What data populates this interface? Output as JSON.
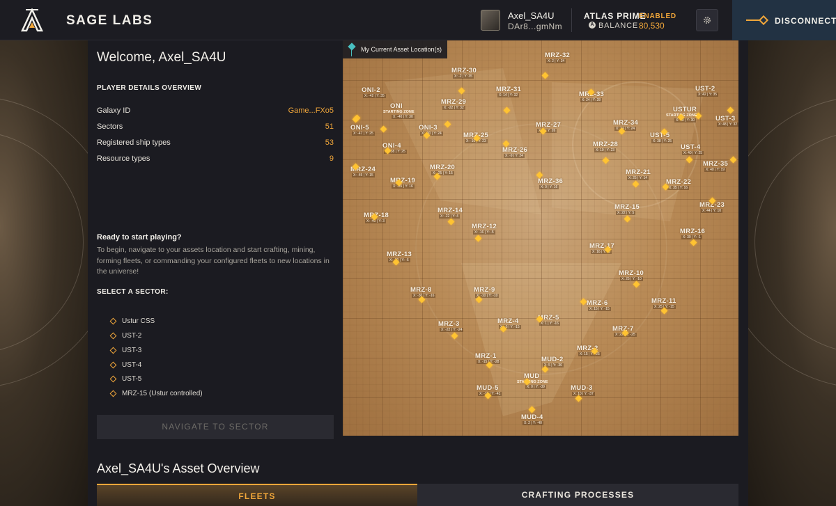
{
  "header": {
    "brand": "SAGE LABS",
    "user_name": "Axel_SA4U",
    "user_wallet": "DAr8...gmNm",
    "atlas_label": "ATLAS PRIME",
    "atlas_status": "ENABLED",
    "balance_label": "BALANCE",
    "balance_value": "80,530",
    "disconnect_label": "DISCONNECT",
    "accent_color": "#f0a63a"
  },
  "welcome": {
    "title": "Welcome, Axel_SA4U"
  },
  "player_details": {
    "heading": "PLAYER DETAILS OVERVIEW",
    "rows": [
      {
        "label": "Galaxy ID",
        "value": "Game...FXo5"
      },
      {
        "label": "Sectors",
        "value": "51"
      },
      {
        "label": "Registered ship types",
        "value": "53"
      },
      {
        "label": "Resource types",
        "value": "9"
      }
    ]
  },
  "ready": {
    "title": "Ready to start playing?",
    "text": "To begin, navigate to your assets location and start crafting, mining, forming fleets, or commanding your configured fleets to new locations in the universe!"
  },
  "select_sector": {
    "heading": "SELECT A SECTOR:",
    "items": [
      "Ustur CSS",
      "UST-2",
      "UST-3",
      "UST-4",
      "UST-5",
      "MRZ-15 (Ustur controlled)"
    ],
    "button": "NAVIGATE TO SECTOR"
  },
  "map": {
    "legend": "My Current Asset Location(s)",
    "sectors": [
      {
        "name": "MRZ-32",
        "coord": "X: 2 | Y: 34",
        "sub": ""
      },
      {
        "name": "MRZ-30",
        "coord": "X: -2 | Y: 35",
        "sub": ""
      },
      {
        "name": "MRZ-31",
        "coord": "X: 14 | Y: 32",
        "sub": ""
      },
      {
        "name": "MRZ-33",
        "coord": "X: 24 | Y: 28",
        "sub": ""
      },
      {
        "name": "ONI-2",
        "coord": "X: -42 | Y: 35",
        "sub": ""
      },
      {
        "name": "ONI",
        "coord": "X: -40 | Y: 30",
        "sub": "STARTING ZONE"
      },
      {
        "name": "MRZ-29",
        "coord": "X: -22 | Y: 32",
        "sub": ""
      },
      {
        "name": "UST-2",
        "coord": "X: 42 | Y: 35",
        "sub": ""
      },
      {
        "name": "USTUR",
        "coord": "X: 40 | Y: 30",
        "sub": "STARTING ZONE"
      },
      {
        "name": "UST-3",
        "coord": "X: 48 | Y: 32",
        "sub": ""
      },
      {
        "name": "ONI-5",
        "coord": "X: -47 | Y: 25",
        "sub": ""
      },
      {
        "name": "ONI-3",
        "coord": "X: -30 | Y: 24",
        "sub": ""
      },
      {
        "name": "MRZ-27",
        "coord": "X: 2 | Y: 26",
        "sub": ""
      },
      {
        "name": "MRZ-34",
        "coord": "X: 24 | Y: 24",
        "sub": ""
      },
      {
        "name": "UST-5",
        "coord": "X: 38 | Y: 25",
        "sub": ""
      },
      {
        "name": "MRZ-25",
        "coord": "X: -10 | Y: 23",
        "sub": ""
      },
      {
        "name": "MRZ-26",
        "coord": "X: -9 | Y: 24",
        "sub": ""
      },
      {
        "name": "ONI-4",
        "coord": "X: -38 | Y: 25",
        "sub": ""
      },
      {
        "name": "MRZ-28",
        "coord": "X: 19 | Y: 23",
        "sub": ""
      },
      {
        "name": "UST-4",
        "coord": "X: 40 | Y: 25",
        "sub": ""
      },
      {
        "name": "MRZ-24",
        "coord": "X: -45 | Y: 15",
        "sub": ""
      },
      {
        "name": "MRZ-20",
        "coord": "X: -25 | Y: 15",
        "sub": ""
      },
      {
        "name": "MRZ-21",
        "coord": "X: 25 | Y: 14",
        "sub": ""
      },
      {
        "name": "MRZ-35",
        "coord": "X: 40 | Y: 19",
        "sub": ""
      },
      {
        "name": "MRZ-19",
        "coord": "X: -35 | Y: 16",
        "sub": ""
      },
      {
        "name": "MRZ-36",
        "coord": "X: 0 | Y: 16",
        "sub": ""
      },
      {
        "name": "MRZ-22",
        "coord": "X: 35 | Y: 16",
        "sub": ""
      },
      {
        "name": "MRZ-23",
        "coord": "X: 44 | Y: 10",
        "sub": ""
      },
      {
        "name": "MRZ-14",
        "coord": "X: -22 | Y: 4",
        "sub": ""
      },
      {
        "name": "MRZ-15",
        "coord": "X: 22 | Y: 5",
        "sub": ""
      },
      {
        "name": "MRZ-18",
        "coord": "X: -40 | Y: 3",
        "sub": ""
      },
      {
        "name": "MRZ-12",
        "coord": "X: -16 | Y: -5",
        "sub": ""
      },
      {
        "name": "MRZ-16",
        "coord": "X: 39 | Y: -1",
        "sub": ""
      },
      {
        "name": "MRZ-17",
        "coord": "X: 16 | Y: -5",
        "sub": ""
      },
      {
        "name": "MRZ-13",
        "coord": "X: -30 | Y: -6",
        "sub": ""
      },
      {
        "name": "MRZ-10",
        "coord": "X: 25 | Y: -10",
        "sub": ""
      },
      {
        "name": "MRZ-8",
        "coord": "X: -30 | Y: -16",
        "sub": ""
      },
      {
        "name": "MRZ-9",
        "coord": "X: -10 | Y: -10",
        "sub": ""
      },
      {
        "name": "MRZ-11",
        "coord": "X: 25 | Y: -15",
        "sub": ""
      },
      {
        "name": "MRZ-6",
        "coord": "X: 15 | Y: -15",
        "sub": ""
      },
      {
        "name": "MRZ-5",
        "coord": "X: 1 | Y: -16",
        "sub": ""
      },
      {
        "name": "MRZ-4",
        "coord": "X: -5 | Y: -15",
        "sub": ""
      },
      {
        "name": "MRZ-3",
        "coord": "X: -22 | Y: -24",
        "sub": ""
      },
      {
        "name": "MRZ-7",
        "coord": "X: 22 | Y: -25",
        "sub": ""
      },
      {
        "name": "MRZ-2",
        "coord": "X: 15 | Y: -25",
        "sub": ""
      },
      {
        "name": "MRZ-1",
        "coord": "X: -15 | Y: -28",
        "sub": ""
      },
      {
        "name": "MUD-2",
        "coord": "X: 5 | Y: -36",
        "sub": ""
      },
      {
        "name": "MUD",
        "coord": "X: 0 | Y: -39",
        "sub": "STARTING ZONE"
      },
      {
        "name": "MUD-5",
        "coord": "X: -10 | Y: -41",
        "sub": ""
      },
      {
        "name": "MUD-3",
        "coord": "X: 10 | Y: -37",
        "sub": ""
      },
      {
        "name": "MUD-4",
        "coord": "X: 2 | Y: -40",
        "sub": ""
      }
    ]
  },
  "assets": {
    "title": "Axel_SA4U's Asset Overview",
    "tabs": [
      "FLEETS",
      "CRAFTING PROCESSES"
    ]
  }
}
